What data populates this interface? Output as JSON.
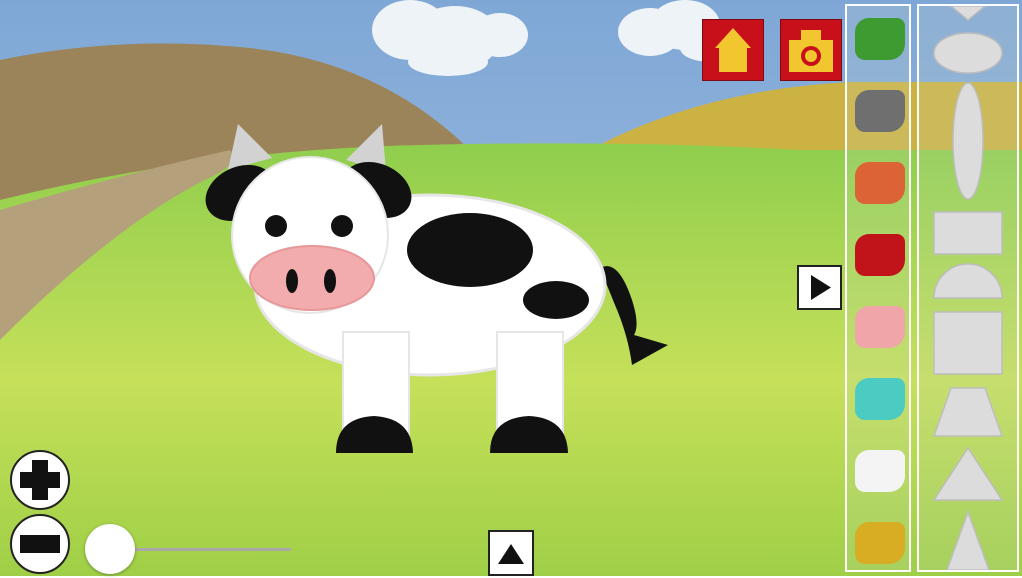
{
  "toolbar": {
    "home_icon": "home-icon",
    "camera_icon": "camera-icon",
    "accent": "#c8101a",
    "icon_color": "#f2c62e"
  },
  "colors": [
    {
      "name": "green",
      "hex": "#3e9b32"
    },
    {
      "name": "gray",
      "hex": "#6f6f6f"
    },
    {
      "name": "orange",
      "hex": "#db6335"
    },
    {
      "name": "red",
      "hex": "#c1141a"
    },
    {
      "name": "pink",
      "hex": "#f0a6a8"
    },
    {
      "name": "teal",
      "hex": "#4ccbc2"
    },
    {
      "name": "white",
      "hex": "#f4f4f4"
    },
    {
      "name": "yellow",
      "hex": "#d8ad23"
    }
  ],
  "shapes": [
    "ellipse",
    "tall-ellipse",
    "rectangle",
    "semicircle",
    "square",
    "trapezoid",
    "triangle",
    "tall-triangle"
  ],
  "controls": {
    "zoom_in_icon": "plus-icon",
    "zoom_out_icon": "minus-icon",
    "size_slider_value": 0
  }
}
